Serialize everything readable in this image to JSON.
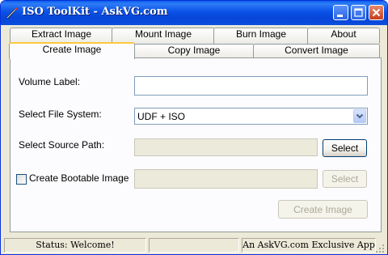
{
  "window": {
    "title": "ISO ToolKit - AskVG.com",
    "minimize_label": "Minimize",
    "maximize_label": "Maximize",
    "close_label": "Close"
  },
  "tabs": {
    "row1": [
      {
        "label": "Extract Image",
        "name": "tab-extract-image"
      },
      {
        "label": "Mount Image",
        "name": "tab-mount-image"
      },
      {
        "label": "Burn Image",
        "name": "tab-burn-image"
      },
      {
        "label": "About",
        "name": "tab-about"
      }
    ],
    "row2": [
      {
        "label": "Create Image",
        "name": "tab-create-image",
        "active": true
      },
      {
        "label": "Copy Image",
        "name": "tab-copy-image"
      },
      {
        "label": "Convert Image",
        "name": "tab-convert-image"
      }
    ]
  },
  "form": {
    "volume_label": "Volume Label:",
    "volume_value": "",
    "file_system_label": "Select File System:",
    "file_system_value": "UDF + ISO",
    "source_path_label": "Select Source Path:",
    "source_path_value": "",
    "select_button": "Select",
    "bootable_label": "Create Bootable Image",
    "bootable_checked": false,
    "bootable_path_value": "",
    "bootable_select_button": "Select",
    "create_button": "Create Image"
  },
  "status": {
    "left": "Status: Welcome!",
    "right": "An AskVG.com Exclusive App"
  },
  "colors": {
    "titlebar": "#0a52e8",
    "window_bg": "#ece9d8",
    "panel_bg": "#fcfcfe",
    "active_tab_accent": "#ffc83c"
  },
  "icons": {
    "app": "pencil-wand-icon",
    "minimize": "minimize-icon",
    "maximize": "maximize-icon",
    "close": "close-icon",
    "dropdown": "chevron-down-icon",
    "grip": "resize-grip-icon"
  }
}
